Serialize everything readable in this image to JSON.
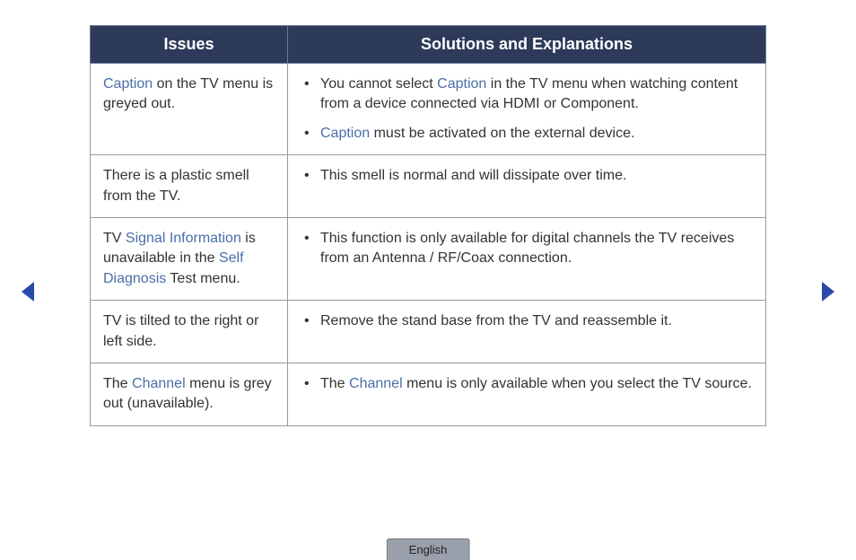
{
  "headers": {
    "issues": "Issues",
    "solutions": "Solutions and Explanations"
  },
  "rows": [
    {
      "issue": {
        "parts": [
          {
            "text": "Caption",
            "highlight": true
          },
          {
            "text": " on the TV menu is greyed out.",
            "highlight": false
          }
        ]
      },
      "solutions": [
        {
          "parts": [
            {
              "text": "You cannot select ",
              "highlight": false
            },
            {
              "text": "Caption",
              "highlight": true
            },
            {
              "text": " in the TV menu when watching content from a device connected via HDMI or Component.",
              "highlight": false
            }
          ]
        },
        {
          "parts": [
            {
              "text": "Caption",
              "highlight": true
            },
            {
              "text": " must be activated on the external device.",
              "highlight": false
            }
          ]
        }
      ]
    },
    {
      "issue": {
        "parts": [
          {
            "text": "There is a plastic smell from the TV.",
            "highlight": false
          }
        ]
      },
      "solutions": [
        {
          "parts": [
            {
              "text": "This smell is normal and will dissipate over time.",
              "highlight": false
            }
          ]
        }
      ]
    },
    {
      "issue": {
        "parts": [
          {
            "text": "TV ",
            "highlight": false
          },
          {
            "text": "Signal Information",
            "highlight": true
          },
          {
            "text": " is unavailable in the ",
            "highlight": false
          },
          {
            "text": "Self Diagnosis",
            "highlight": true
          },
          {
            "text": " Test menu.",
            "highlight": false
          }
        ]
      },
      "solutions": [
        {
          "parts": [
            {
              "text": "This function is only available for digital channels the TV receives from an Antenna / RF/Coax connection.",
              "highlight": false
            }
          ]
        }
      ]
    },
    {
      "issue": {
        "parts": [
          {
            "text": "TV is tilted to the right or left side.",
            "highlight": false
          }
        ]
      },
      "solutions": [
        {
          "parts": [
            {
              "text": "Remove the stand base from the TV and reassemble it.",
              "highlight": false
            }
          ]
        }
      ]
    },
    {
      "issue": {
        "parts": [
          {
            "text": "The ",
            "highlight": false
          },
          {
            "text": "Channel",
            "highlight": true
          },
          {
            "text": " menu is grey out (unavailable).",
            "highlight": false
          }
        ]
      },
      "solutions": [
        {
          "parts": [
            {
              "text": "The ",
              "highlight": false
            },
            {
              "text": "Channel",
              "highlight": true
            },
            {
              "text": " menu is only available when you select the TV source.",
              "highlight": false
            }
          ]
        }
      ]
    }
  ],
  "language": "English"
}
